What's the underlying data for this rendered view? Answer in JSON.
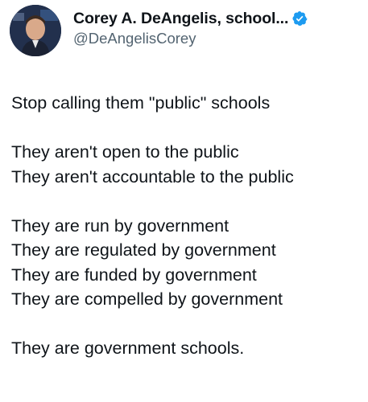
{
  "author": {
    "display_name": "Corey A. DeAngelis, school...",
    "handle": "@DeAngelisCorey",
    "verified_color": "#1d9bf0"
  },
  "tweet": {
    "lines": [
      "Stop calling them \"public\" schools",
      "",
      "They aren't open to the public",
      "They aren't accountable to the public",
      "",
      "They are run by government",
      "They are regulated by government",
      "They are funded by government",
      "They are compelled by government",
      "",
      "They are government schools."
    ]
  },
  "colors": {
    "text": "#0f1419",
    "secondary": "#536471",
    "background": "#ffffff"
  },
  "icons": [
    "avatar",
    "verified-badge-icon"
  ]
}
